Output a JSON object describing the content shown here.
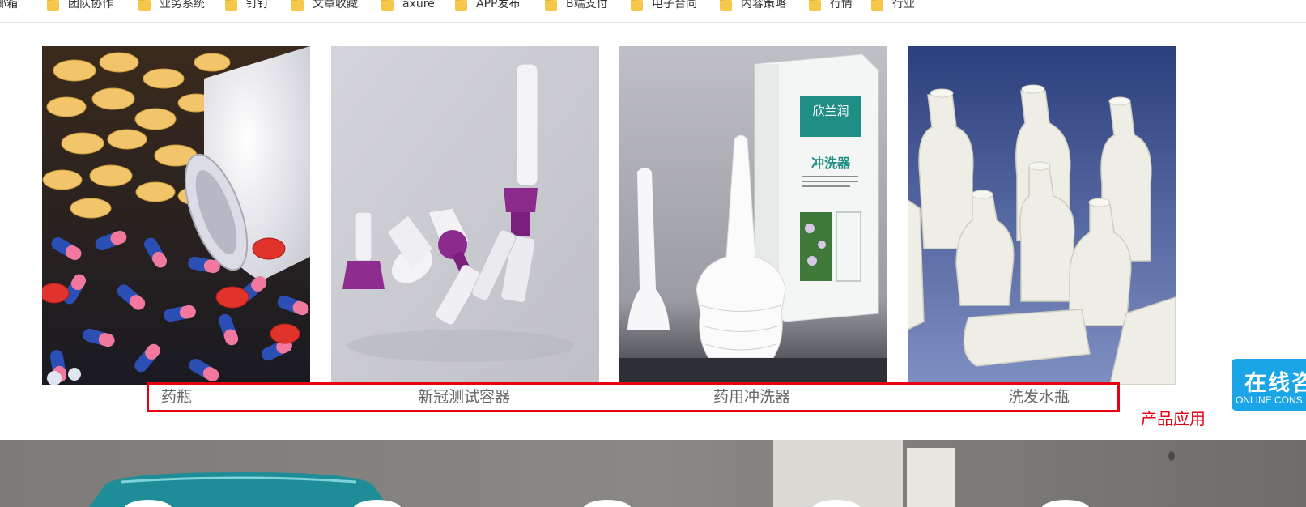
{
  "bookmarks": [
    {
      "label": "邮箱",
      "icon": "folder-icon"
    },
    {
      "label": "团队协作",
      "icon": "folder-icon"
    },
    {
      "label": "业务系统",
      "icon": "folder-icon"
    },
    {
      "label": "钉钉",
      "icon": "folder-icon"
    },
    {
      "label": "文章收藏",
      "icon": "folder-icon"
    },
    {
      "label": "axure",
      "icon": "folder-icon"
    },
    {
      "label": "APP发布",
      "icon": "folder-icon"
    },
    {
      "label": "B端支付",
      "icon": "folder-icon"
    },
    {
      "label": "电子合同",
      "icon": "folder-icon"
    },
    {
      "label": "内容策略",
      "icon": "folder-icon"
    },
    {
      "label": "行情",
      "icon": "folder-icon"
    },
    {
      "label": "行业",
      "icon": "folder-icon"
    }
  ],
  "products": [
    {
      "name": "药瓶",
      "image": "pills-and-white-bottle"
    },
    {
      "name": "新冠测试容器",
      "image": "purple-cap-test-tubes"
    },
    {
      "name": "药用冲洗器",
      "image": "douche-applicator-and-box"
    },
    {
      "name": "洗发水瓶",
      "image": "white-shampoo-bottles"
    }
  ],
  "product_box_text": {
    "brand": "欣兰润",
    "product": "冲洗器"
  },
  "section_label": "产品应用",
  "consult": {
    "title": "在线咨",
    "subtitle": "ONLINE CONS"
  },
  "colors": {
    "highlight_border": "#e60012",
    "consult_bg": "#1aa5e6",
    "caption_text": "#666666"
  }
}
